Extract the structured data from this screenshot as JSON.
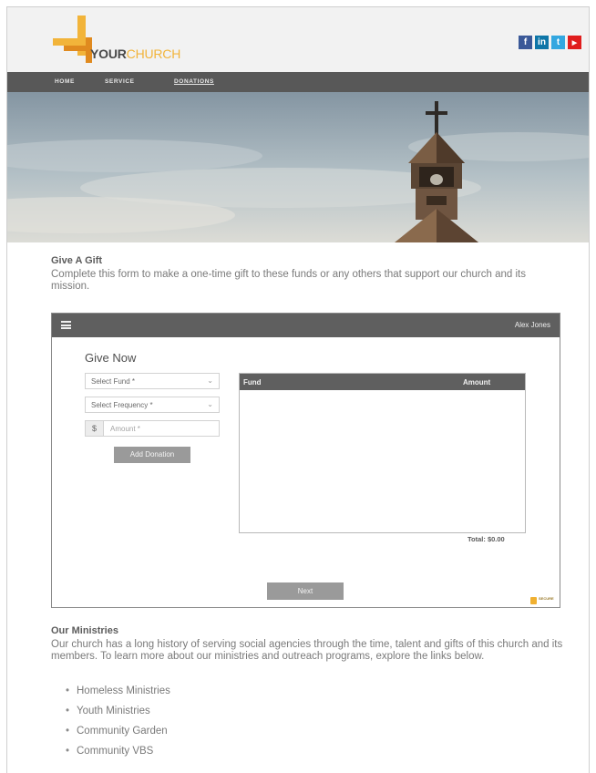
{
  "header": {
    "logo_word1": "YOUR",
    "logo_word2": "CHURCH",
    "social": [
      {
        "icon": "facebook-icon",
        "glyph": "f",
        "color": "#3b5998"
      },
      {
        "icon": "linkedin-icon",
        "glyph": "in",
        "color": "#0e76a8"
      },
      {
        "icon": "twitter-icon",
        "glyph": "t",
        "color": "#33a7e0"
      },
      {
        "icon": "youtube-icon",
        "glyph": "▶",
        "color": "#e01e1e"
      }
    ]
  },
  "nav": {
    "items": [
      "HOME",
      "SERVICE",
      "DONATIONS"
    ],
    "active": "DONATIONS"
  },
  "gift": {
    "title": "Give A Gift",
    "text": "Complete this form to make a one-time gift to these funds or any others that support our church and its mission."
  },
  "widget": {
    "user_name": "Alex Jones",
    "heading": "Give Now",
    "fund_select": "Select Fund *",
    "frequency_select": "Select Frequency *",
    "currency_symbol": "$",
    "amount_placeholder": "Amount *",
    "add_button": "Add Donation",
    "table": {
      "col_fund": "Fund",
      "col_amount": "Amount",
      "rows": []
    },
    "total": "Total: $0.00",
    "next_button": "Next",
    "secure_badge": "SECURE"
  },
  "ministries": {
    "title": "Our Ministries",
    "text": "Our church has a long history of serving social agencies through the time, talent and gifts of this church and its members. To learn more about our ministries and outreach programs, explore the links below.",
    "links": [
      "Homeless Ministries",
      "Youth Ministries",
      "Community Garden",
      "Community VBS"
    ]
  },
  "colors": {
    "accent_gold": "#f2b43a",
    "accent_orange": "#e08a1f",
    "nav_gray": "#585858",
    "button_gray": "#9a9a9a"
  }
}
